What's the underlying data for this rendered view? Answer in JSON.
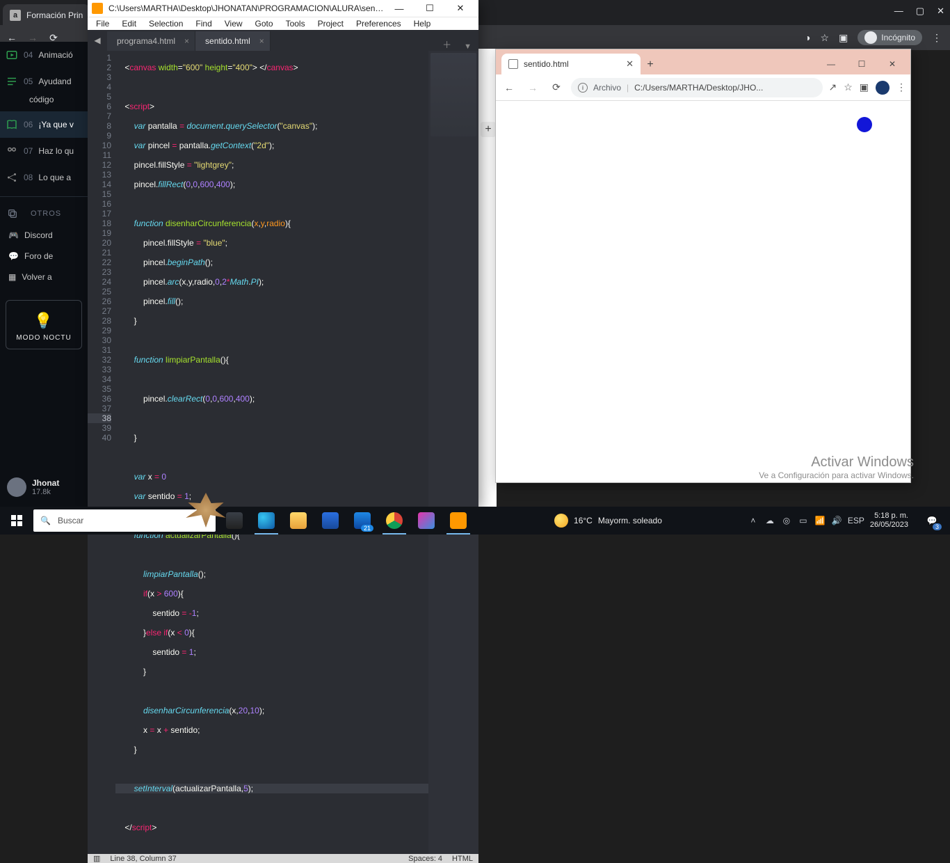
{
  "bg_chrome": {
    "tab_title": "Formación Prin",
    "tab_favicon_letter": "a",
    "new_tab_plus": "+",
    "incognito_label": "Incógnito"
  },
  "alura": {
    "items": [
      {
        "num": "04",
        "label": "Animació"
      },
      {
        "num": "05",
        "label": "Ayudand"
      },
      {
        "num": "",
        "label": "código"
      },
      {
        "num": "06",
        "label": "¡Ya que v"
      },
      {
        "num": "07",
        "label": "Haz lo qu"
      },
      {
        "num": "08",
        "label": "Lo que a"
      }
    ],
    "section_label": "OTROS",
    "links": [
      "Discord",
      "Foro de",
      "Volver a"
    ],
    "nocturno": "MODO NOCTU",
    "user_name": "Jhonat",
    "user_points": "17.8k"
  },
  "sublime": {
    "window_title": "C:\\Users\\MARTHA\\Desktop\\JHONATAN\\PROGRAMACION\\ALURA\\senti...",
    "menu": [
      "File",
      "Edit",
      "Selection",
      "Find",
      "View",
      "Goto",
      "Tools",
      "Project",
      "Preferences",
      "Help"
    ],
    "tabs": [
      {
        "label": "programa4.html",
        "active": false
      },
      {
        "label": "sentido.html",
        "active": true
      }
    ],
    "status_left": "Line 38, Column 37",
    "status_spaces": "Spaces: 4",
    "status_lang": "HTML",
    "code_numbers": [
      "1",
      "2",
      "3",
      "4",
      "5",
      "6",
      "7",
      "8",
      "9",
      "10",
      "11",
      "12",
      "13",
      "14",
      "15",
      "16",
      "17",
      "18",
      "19",
      "20",
      "21",
      "22",
      "23",
      "24",
      "25",
      "26",
      "27",
      "28",
      "29",
      "30",
      "31",
      "32",
      "33",
      "34",
      "35",
      "36",
      "37",
      "38",
      "39",
      "40"
    ]
  },
  "chrome2": {
    "tab_title": "sentido.html",
    "addr_label": "Archivo",
    "addr_path": "C:/Users/MARTHA/Desktop/JHO..."
  },
  "watermark": {
    "title": "Activar Windows",
    "sub": "Ve a Configuración para activar Windows."
  },
  "taskbar": {
    "search_placeholder": "Buscar",
    "weather_temp": "16°C",
    "weather_desc": "Mayorm. soleado",
    "lang": "ESP",
    "time": "5:18 p. m.",
    "date": "26/05/2023",
    "notif_count": "3"
  },
  "mid_plus": "+"
}
